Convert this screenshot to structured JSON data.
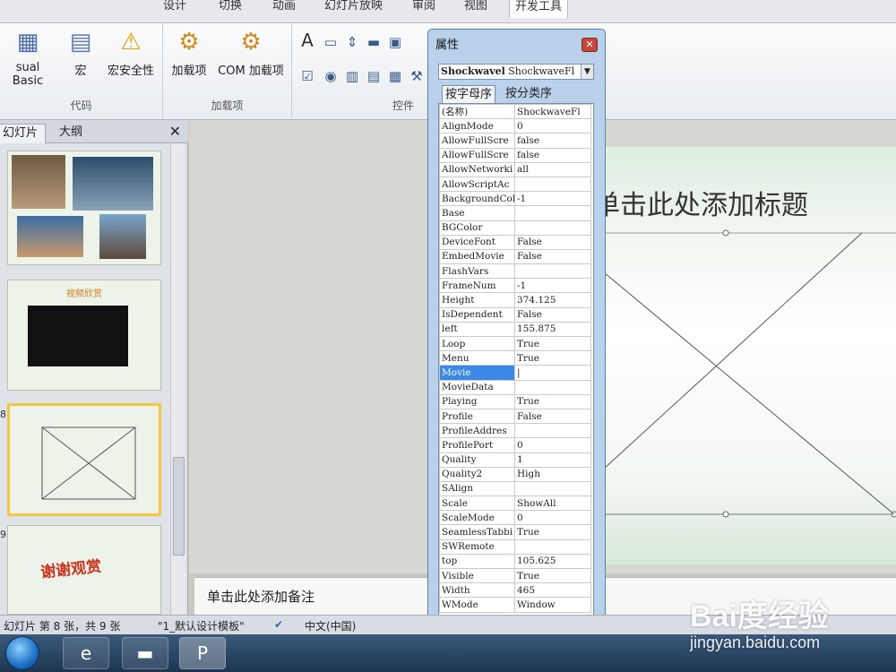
{
  "ribbon": {
    "tabs": [
      "设计",
      "切换",
      "动画",
      "幻灯片放映",
      "审阅",
      "视图",
      "开发工具"
    ],
    "active_tab": "开发工具",
    "group_code": {
      "label": "代码",
      "visual_basic": "sual Basic",
      "macro": "宏",
      "macro_security": "宏安全性"
    },
    "group_addins": {
      "label": "加载项",
      "addins": "加载项",
      "com_addins": "COM 加载项"
    },
    "group_controls": {
      "label": "控件"
    }
  },
  "slide_pane": {
    "tab_slides": "幻灯片",
    "tab_outline": "大纲",
    "close": "✕",
    "slide_numbers": [
      "8",
      "9"
    ],
    "thumb2_title": "视频欣赏",
    "thumb4_text": "谢谢观赏"
  },
  "slide": {
    "title_placeholder": "单击此处添加标题"
  },
  "notes": {
    "placeholder": "单击此处添加备注"
  },
  "status": {
    "slide_info": "幻灯片 第 8 张，共 9 张",
    "theme": "\"1_默认设计模板\"",
    "language": "中文(中国)"
  },
  "properties": {
    "title": "属性",
    "object_name": "Shockwavel",
    "object_type": "ShockwaveFl",
    "tab_alpha": "按字母序",
    "tab_category": "按分类序",
    "rows": [
      {
        "key": "(名称)",
        "value": "ShockwaveFl"
      },
      {
        "key": "AlignMode",
        "value": "0"
      },
      {
        "key": "AllowFullScre",
        "value": "false"
      },
      {
        "key": "AllowFullScre",
        "value": "false"
      },
      {
        "key": "AllowNetworki",
        "value": "all"
      },
      {
        "key": "AllowScriptAc",
        "value": ""
      },
      {
        "key": "BackgroundCol",
        "value": "-1"
      },
      {
        "key": "Base",
        "value": ""
      },
      {
        "key": "BGColor",
        "value": ""
      },
      {
        "key": "DeviceFont",
        "value": "False"
      },
      {
        "key": "EmbedMovie",
        "value": "False"
      },
      {
        "key": "FlashVars",
        "value": ""
      },
      {
        "key": "FrameNum",
        "value": "-1"
      },
      {
        "key": "Height",
        "value": "374.125"
      },
      {
        "key": "IsDependent",
        "value": "False"
      },
      {
        "key": "left",
        "value": "155.875"
      },
      {
        "key": "Loop",
        "value": "True"
      },
      {
        "key": "Menu",
        "value": "True"
      },
      {
        "key": "Movie",
        "value": "|"
      },
      {
        "key": "MovieData",
        "value": ""
      },
      {
        "key": "Playing",
        "value": "True"
      },
      {
        "key": "Profile",
        "value": "False"
      },
      {
        "key": "ProfileAddres",
        "value": ""
      },
      {
        "key": "ProfilePort",
        "value": "0"
      },
      {
        "key": "Quality",
        "value": "1"
      },
      {
        "key": "Quality2",
        "value": "High"
      },
      {
        "key": "SAlign",
        "value": ""
      },
      {
        "key": "Scale",
        "value": "ShowAll"
      },
      {
        "key": "ScaleMode",
        "value": "0"
      },
      {
        "key": "SeamlessTabbi",
        "value": "True"
      },
      {
        "key": "SWRemote",
        "value": ""
      },
      {
        "key": "top",
        "value": "105.625"
      },
      {
        "key": "Visible",
        "value": "True"
      },
      {
        "key": "Width",
        "value": "465"
      },
      {
        "key": "WMode",
        "value": "Window"
      }
    ],
    "selected_row": "Movie"
  },
  "watermark": {
    "logo": "Bai度经验",
    "url": "jingyan.baidu.com"
  },
  "colors": {
    "selection": "#3b88e6",
    "thumb_selected_border": "#f2c545",
    "accent_taskbar": "#1d3552"
  }
}
